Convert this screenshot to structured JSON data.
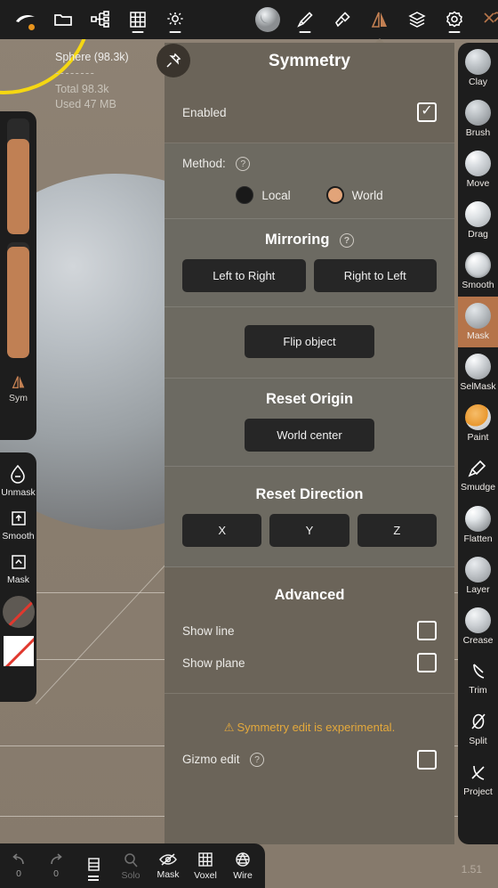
{
  "app": {
    "version": "1.51"
  },
  "topbar": {
    "left_items": [
      {
        "name": "logo-icon",
        "label": "logo"
      },
      {
        "name": "folder-icon",
        "label": "Files"
      },
      {
        "name": "scene-graph-icon",
        "label": "Scene"
      },
      {
        "name": "grid-icon",
        "label": "Grid"
      },
      {
        "name": "light-icon",
        "label": "Light"
      }
    ],
    "right_items": [
      {
        "name": "material-sphere-icon",
        "label": "Material"
      },
      {
        "name": "brush-icon",
        "label": "Brush"
      },
      {
        "name": "stamp-icon",
        "label": "Stamp"
      },
      {
        "name": "symmetry-icon",
        "label": "Symmetry"
      },
      {
        "name": "layers-icon",
        "label": "Layers"
      },
      {
        "name": "gear-icon",
        "label": "Settings"
      },
      {
        "name": "tools-icon",
        "label": "Tools"
      }
    ]
  },
  "stats": {
    "object": "Sphere (98.3k)",
    "divider": "--------",
    "total": "Total 98.3k",
    "used": "Used 47 MB"
  },
  "left_rail": {
    "sliders": [
      {
        "name": "radius-slider",
        "fill_pct": 82
      },
      {
        "name": "intensity-slider",
        "fill_pct": 96
      }
    ],
    "sym_label": "Sym"
  },
  "left_rail2": {
    "items": [
      {
        "name": "unmask-button",
        "label": "Unmask",
        "icon": "droplet-minus-icon"
      },
      {
        "name": "smooth-mask-button",
        "label": "Smooth",
        "icon": "arrow-up-box-icon"
      },
      {
        "name": "mask-button",
        "label": "Mask",
        "icon": "caret-up-box-icon"
      }
    ],
    "swatches": [
      {
        "name": "alpha-swatch-none",
        "kind": "round"
      },
      {
        "name": "texture-swatch-none",
        "kind": "square"
      }
    ]
  },
  "right_rail": {
    "tools": [
      {
        "label": "Clay",
        "selected": false
      },
      {
        "label": "Brush",
        "selected": false
      },
      {
        "label": "Move",
        "selected": false
      },
      {
        "label": "Drag",
        "selected": false
      },
      {
        "label": "Smooth",
        "selected": false
      },
      {
        "label": "Mask",
        "selected": true
      },
      {
        "label": "SelMask",
        "selected": false
      },
      {
        "label": "Paint",
        "selected": false
      },
      {
        "label": "Smudge",
        "selected": false
      },
      {
        "label": "Flatten",
        "selected": false
      },
      {
        "label": "Layer",
        "selected": false
      },
      {
        "label": "Crease",
        "selected": false
      },
      {
        "label": "Trim",
        "selected": false
      },
      {
        "label": "Split",
        "selected": false
      },
      {
        "label": "Project",
        "selected": false
      }
    ],
    "selected_color": "#b5744a"
  },
  "bottombar": {
    "undo": {
      "label": "",
      "count": "0"
    },
    "redo": {
      "label": "",
      "count": "0"
    },
    "layers": {
      "label": ""
    },
    "solo": {
      "label": "Solo",
      "enabled": false
    },
    "mask": {
      "label": "Mask"
    },
    "voxel": {
      "label": "Voxel"
    },
    "wire": {
      "label": "Wire"
    }
  },
  "panel": {
    "title": "Symmetry",
    "pin_icon": "pin-icon",
    "enabled": {
      "label": "Enabled",
      "checked": true,
      "check_glyph": "✓"
    },
    "method": {
      "label": "Method:",
      "options": [
        {
          "label": "Local",
          "selected": false
        },
        {
          "label": "World",
          "selected": true
        }
      ]
    },
    "mirroring": {
      "title": "Mirroring",
      "buttons": [
        {
          "label": "Left to Right"
        },
        {
          "label": "Right to Left"
        }
      ],
      "flip": {
        "label": "Flip object"
      }
    },
    "reset_origin": {
      "title": "Reset Origin",
      "button": {
        "label": "World center"
      }
    },
    "reset_direction": {
      "title": "Reset Direction",
      "buttons": [
        {
          "label": "X"
        },
        {
          "label": "Y"
        },
        {
          "label": "Z"
        }
      ]
    },
    "advanced": {
      "title": "Advanced",
      "show_line": {
        "label": "Show line",
        "checked": false
      },
      "show_plane": {
        "label": "Show plane",
        "checked": false
      },
      "warning": {
        "icon": "⚠",
        "text": "Symmetry edit is experimental.",
        "color": "#e4a93c"
      },
      "gizmo_edit": {
        "label": "Gizmo edit",
        "checked": false
      }
    }
  }
}
